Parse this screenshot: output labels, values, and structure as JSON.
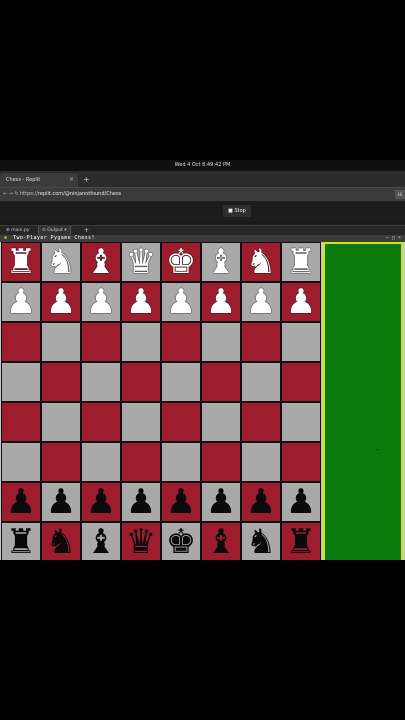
{
  "system": {
    "clock": "Wed 4 Oct   8:49:42 PM"
  },
  "browser": {
    "tab_title": "Chess - Replit",
    "tab_close": "×",
    "new_tab": "+",
    "url_prefix": "https://",
    "url_body": "replit.com/@ninjanotfound/Chess",
    "addr_icons": "← → ↻",
    "addr_right": "Hi"
  },
  "replit": {
    "stop_label": "■ Stop",
    "pane_tabs": [
      {
        "label": "⊕ main.py",
        "active": false
      },
      {
        "label": "⊙ Output  ▾",
        "active": true
      }
    ],
    "pane_add": "+"
  },
  "game_window": {
    "title": "Two-Player Pygame Chess!",
    "logo": "●",
    "controls": "– □ ×",
    "side_panel_color": "#0a7a0a",
    "board_dark_color": "#9d1d2e",
    "board_light_color": "#a9a9a9"
  },
  "board": {
    "rows": [
      [
        "♜",
        "♞",
        "♝",
        "♛",
        "♚",
        "♝",
        "♞",
        "♜"
      ],
      [
        "♟",
        "♟",
        "♟",
        "♟",
        "♟",
        "♟",
        "♟",
        "♟"
      ],
      [
        "",
        "",
        "",
        "",
        "",
        "",
        "",
        ""
      ],
      [
        "",
        "",
        "",
        "",
        "",
        "",
        "",
        ""
      ],
      [
        "",
        "",
        "",
        "",
        "",
        "",
        "",
        ""
      ],
      [
        "",
        "",
        "",
        "",
        "",
        "",
        "",
        ""
      ],
      [
        "♟",
        "♟",
        "♟",
        "♟",
        "♟",
        "♟",
        "♟",
        "♟"
      ],
      [
        "♜",
        "♞",
        "♝",
        "♛",
        "♚",
        "♝",
        "♞",
        "♜"
      ]
    ],
    "colors": [
      "white",
      "white",
      "",
      "",
      "",
      "",
      "black",
      "black"
    ]
  },
  "cursor": "⌖"
}
